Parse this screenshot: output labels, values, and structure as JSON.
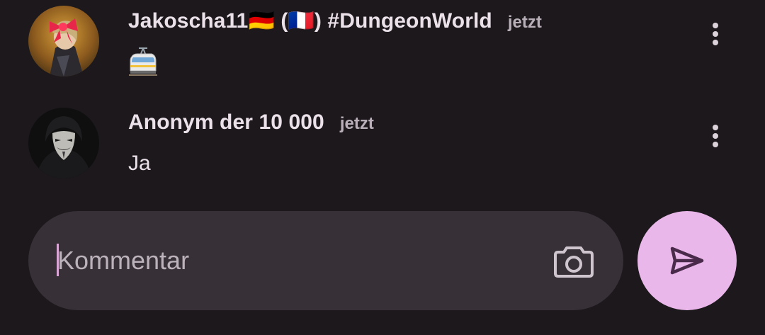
{
  "comments": [
    {
      "author": "Jakoscha11🇩🇪 (🇫🇷) #DungeonWorld",
      "time": "jetzt",
      "body_icon": "tram-icon"
    },
    {
      "author": "Anonym der 10 000",
      "time": "jetzt",
      "body": "Ja"
    }
  ],
  "composer": {
    "placeholder": "Kommentar",
    "camera_icon": "camera-icon",
    "send_icon": "send-icon"
  },
  "colors": {
    "background": "#1c181c",
    "composer": "#373137",
    "send_button": "#eab7ea",
    "send_icon": "#4a2a4a",
    "caret": "#d9a6d6"
  }
}
